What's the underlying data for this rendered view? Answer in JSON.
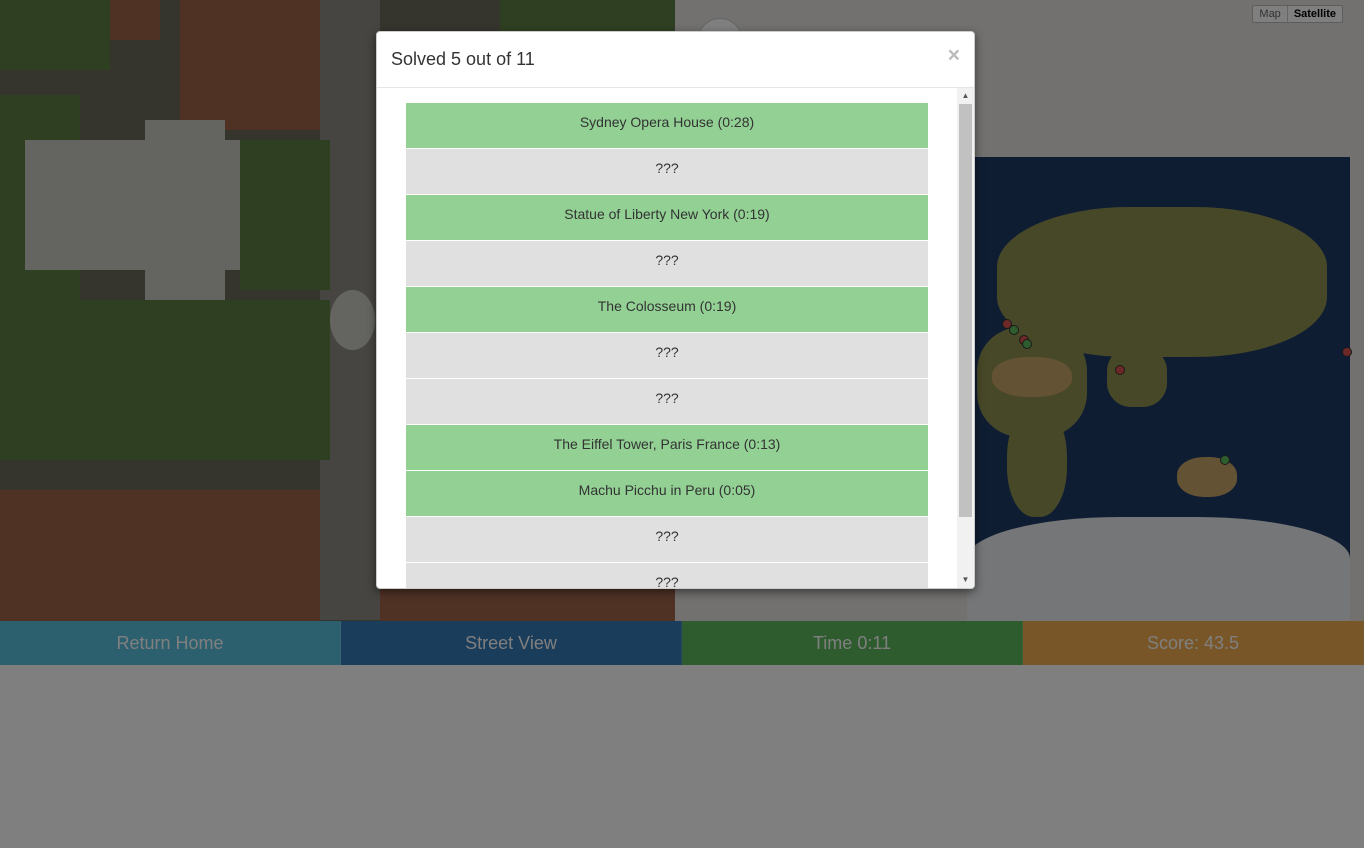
{
  "modal": {
    "title": "Solved 5 out of 11",
    "close_glyph": "×",
    "results": [
      {
        "label": "Sydney Opera House (0:28)",
        "status": "solved"
      },
      {
        "label": "???",
        "status": "unsolved"
      },
      {
        "label": "Statue of Liberty New York (0:19)",
        "status": "solved"
      },
      {
        "label": "???",
        "status": "unsolved"
      },
      {
        "label": "The Colosseum (0:19)",
        "status": "solved"
      },
      {
        "label": "???",
        "status": "unsolved"
      },
      {
        "label": "???",
        "status": "unsolved"
      },
      {
        "label": "The Eiffel Tower, Paris France (0:13)",
        "status": "solved"
      },
      {
        "label": "Machu Picchu in Peru (0:05)",
        "status": "solved"
      },
      {
        "label": "???",
        "status": "unsolved"
      },
      {
        "label": "???",
        "status": "unsolved"
      }
    ]
  },
  "map": {
    "type_options": [
      "Map",
      "Satellite"
    ],
    "selected_type": "Satellite"
  },
  "bottom_bar": {
    "home_label": "Return Home",
    "street_label": "Street View",
    "time_label": "Time 0:11",
    "score_label": "Score: 43.5"
  },
  "colors": {
    "solved": "#92d094",
    "unsolved": "#e0e0e0",
    "home": "#5bc0de",
    "street": "#337ab7",
    "time": "#5cb85c",
    "score": "#f0ad4e"
  }
}
